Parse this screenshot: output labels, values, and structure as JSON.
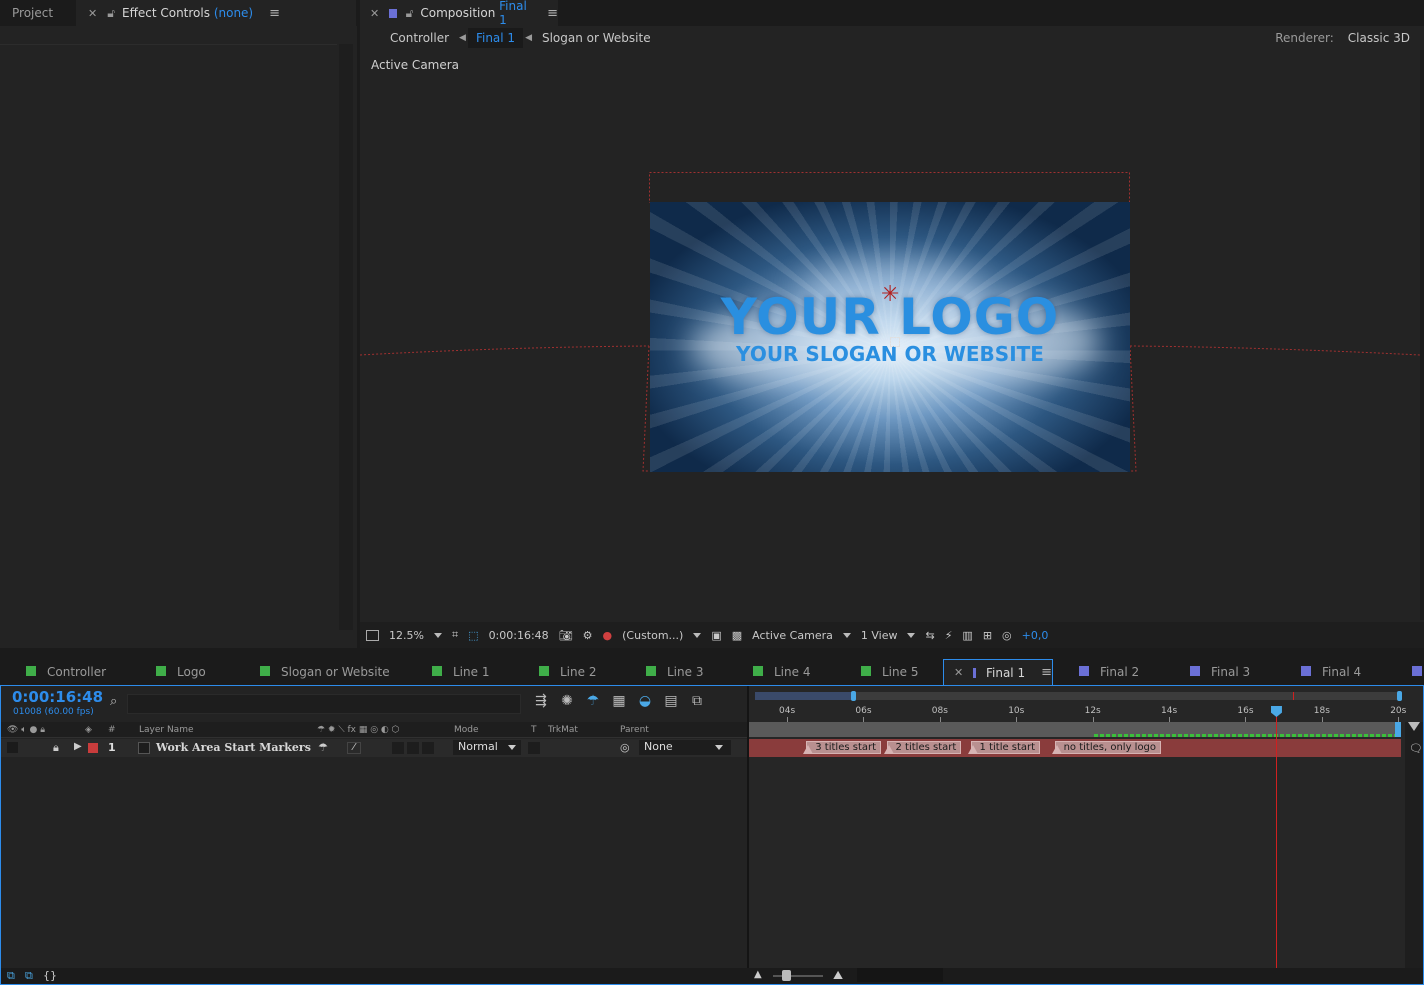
{
  "left_panel": {
    "tabs": [
      {
        "label": "Project"
      },
      {
        "label": "Effect Controls",
        "suffix": "(none)"
      }
    ]
  },
  "composition": {
    "tab_label": "Composition",
    "tab_comp": "Final 1",
    "breadcrumbs": [
      "Controller",
      "Final 1",
      "Slogan or Website"
    ],
    "renderer_label": "Renderer:",
    "renderer_value": "Classic 3D",
    "view_label": "Active Camera",
    "logo_text": "YOUR LOGO",
    "slogan_text": "YOUR SLOGAN OR WEBSITE",
    "viewer_bar": {
      "zoom": "12.5%",
      "timecode": "0:00:16:48",
      "resolution": "(Custom...)",
      "camera": "Active Camera",
      "views": "1 View",
      "exposure": "+0,0"
    }
  },
  "timeline_tabs": [
    {
      "label": "Controller",
      "color": "#3fae49"
    },
    {
      "label": "Logo",
      "color": "#3fae49"
    },
    {
      "label": "Slogan or Website",
      "color": "#3fae49"
    },
    {
      "label": "Line 1",
      "color": "#3fae49"
    },
    {
      "label": "Line 2",
      "color": "#3fae49"
    },
    {
      "label": "Line 3",
      "color": "#3fae49"
    },
    {
      "label": "Line 4",
      "color": "#3fae49"
    },
    {
      "label": "Line 5",
      "color": "#3fae49"
    },
    {
      "label": "Final 1",
      "color": "#6b70d6"
    },
    {
      "label": "Final 2",
      "color": "#6b70d6"
    },
    {
      "label": "Final 3",
      "color": "#6b70d6"
    },
    {
      "label": "Final 4",
      "color": "#6b70d6"
    }
  ],
  "timeline": {
    "timecode": "0:00:16:48",
    "frames": "01008 (60.00 fps)",
    "search_placeholder": "",
    "columns": {
      "num": "#",
      "layer_name": "Layer Name",
      "mode": "Mode",
      "t": "T",
      "trkmat": "TrkMat",
      "parent": "Parent"
    },
    "layer": {
      "number": "1",
      "name": "Work Area Start Markers",
      "mode": "Normal",
      "parent": "None",
      "label_color": "#c83c3c"
    },
    "ruler_ticks": [
      "04s",
      "06s",
      "08s",
      "10s",
      "12s",
      "14s",
      "16s",
      "18s",
      "20s"
    ],
    "markers": [
      {
        "label": "3 titles start",
        "time_s": 4.4
      },
      {
        "label": "2 titles start",
        "time_s": 6.5
      },
      {
        "label": "1 title start",
        "time_s": 8.7
      },
      {
        "label": "no titles, only logo",
        "time_s": 10.9
      }
    ],
    "playhead_s": 16.8,
    "accent": "#2d8ceb"
  }
}
